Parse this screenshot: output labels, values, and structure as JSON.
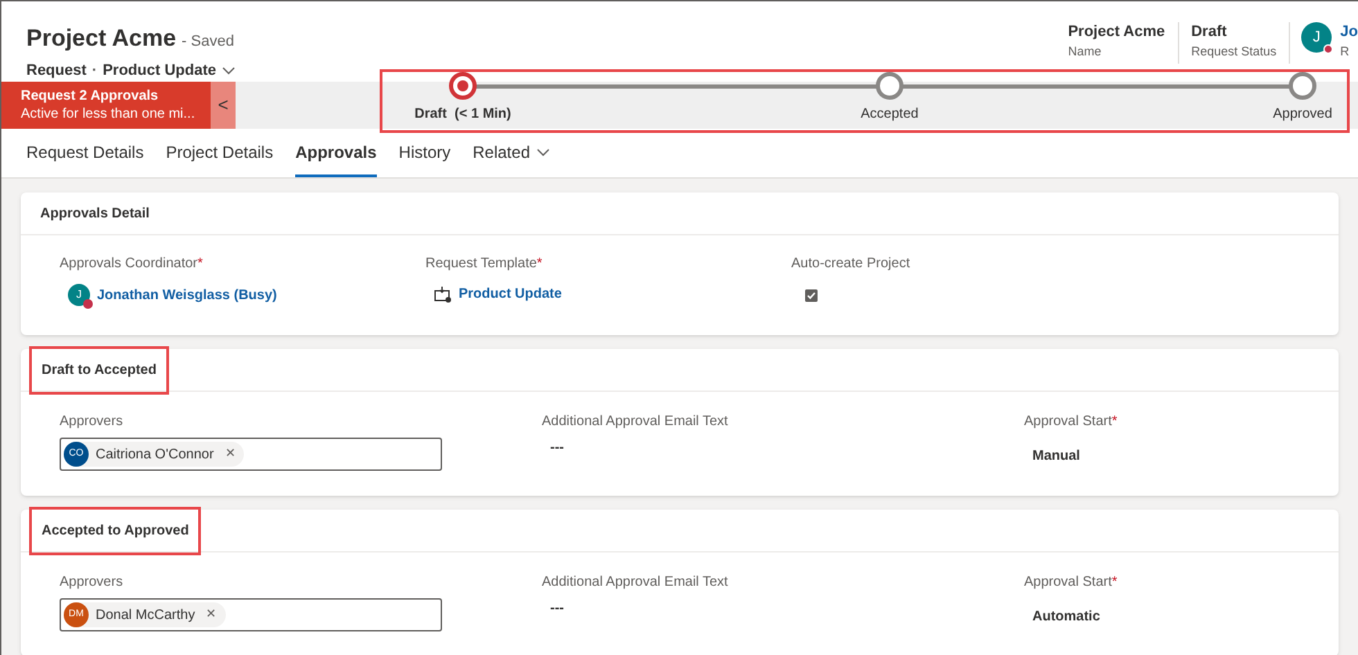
{
  "header": {
    "title": "Project Acme",
    "save_status": "- Saved",
    "entity": "Request",
    "separator": "·",
    "form": "Product Update",
    "fields": [
      {
        "value": "Project Acme",
        "label": "Name"
      },
      {
        "value": "Draft",
        "label": "Request Status"
      }
    ],
    "owner": {
      "initial": "J",
      "name": "Jo",
      "role": "R",
      "busy": true
    }
  },
  "process": {
    "name": "Request 2 Approvals",
    "subtitle": "Active for less than one mi...",
    "collapse": "<",
    "highlighted": true,
    "stages": [
      {
        "label": "Draft",
        "duration": "(< 1 Min)",
        "selected": true
      },
      {
        "label": "Accepted",
        "selected": false
      },
      {
        "label": "Approved",
        "selected": false
      }
    ]
  },
  "tabs": [
    {
      "label": "Request Details",
      "selected": false
    },
    {
      "label": "Project Details",
      "selected": false
    },
    {
      "label": "Approvals",
      "selected": true
    },
    {
      "label": "History",
      "selected": false
    },
    {
      "label": "Related",
      "selected": false,
      "dropdown": true
    }
  ],
  "detail": {
    "title": "Approvals Detail",
    "coordinator": {
      "label": "Approvals Coordinator",
      "required": "*",
      "initial": "J",
      "value": "Jonathan Weisglass (Busy)"
    },
    "template": {
      "label": "Request Template",
      "required": "*",
      "value": "Product Update"
    },
    "auto_create": {
      "label": "Auto-create Project",
      "checked": true
    }
  },
  "sections": [
    {
      "title": "Draft to Accepted",
      "highlighted": true,
      "approvers_label": "Approvers",
      "approver": {
        "initials": "CO",
        "name": "Caitriona O'Connor",
        "color": "#004e8c"
      },
      "remove": "✕",
      "email_label": "Additional Approval Email Text",
      "email_value": "---",
      "start_label": "Approval Start",
      "required": "*",
      "start_value": "Manual"
    },
    {
      "title": "Accepted to Approved",
      "highlighted": true,
      "approvers_label": "Approvers",
      "approver": {
        "initials": "DM",
        "name": "Donal McCarthy",
        "color": "#ca5010"
      },
      "remove": "✕",
      "email_label": "Additional Approval Email Text",
      "email_value": "---",
      "start_label": "Approval Start",
      "required": "*",
      "start_value": "Automatic"
    }
  ]
}
